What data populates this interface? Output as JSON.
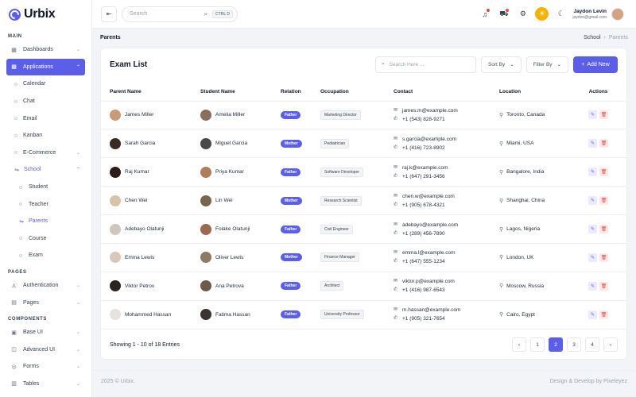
{
  "app": {
    "name": "Urbix"
  },
  "sidebar": {
    "sections": [
      {
        "label": "MAIN"
      },
      {
        "label": "PAGES"
      },
      {
        "label": "COMPONENTS"
      }
    ],
    "items": [
      {
        "label": "Dashboards",
        "icon": "grid-icon"
      },
      {
        "label": "Applications",
        "icon": "apps-icon"
      },
      {
        "label": "Calendar"
      },
      {
        "label": "Chat"
      },
      {
        "label": "Email"
      },
      {
        "label": "Kanban"
      },
      {
        "label": "E-Commerce"
      },
      {
        "label": "School"
      },
      {
        "label": "Student"
      },
      {
        "label": "Teacher"
      },
      {
        "label": "Parents"
      },
      {
        "label": "Course"
      },
      {
        "label": "Exam"
      },
      {
        "label": "Authentication"
      },
      {
        "label": "Pages"
      },
      {
        "label": "Base UI"
      },
      {
        "label": "Advanced UI"
      },
      {
        "label": "Forms"
      },
      {
        "label": "Tables"
      }
    ]
  },
  "header": {
    "search_placeholder": "Search",
    "shortcut": "CTRL D",
    "user_name": "Jaydon Levin",
    "user_email": "jaydon@gmail.com"
  },
  "breadcrumb": {
    "title": "Parents",
    "root": "School",
    "current": "Parents"
  },
  "card": {
    "title": "Exam List",
    "search_placeholder": "Search Here ...",
    "sort_label": "Sort By",
    "filter_label": "Filter By",
    "add_label": "Add New"
  },
  "table": {
    "headers": [
      "Parent Name",
      "Student Name",
      "Relation",
      "Occupation",
      "Contact",
      "Location",
      "Actions"
    ],
    "rows": [
      {
        "parent": "James Miller",
        "student": "Amelia Miller",
        "relation": "Father",
        "occupation": "Marketing Director",
        "email": "james.m@example.com",
        "phone": "+1 (543) 828-9271",
        "location": "Toronto, Canada",
        "pcolor": "#c79a7a",
        "scolor": "#8a6f5e"
      },
      {
        "parent": "Sarah Garcia",
        "student": "Miguel Garcia",
        "relation": "Mother",
        "occupation": "Pediatrician",
        "email": "s.garcia@example.com",
        "phone": "+1 (416) 723-8902",
        "location": "Miami, USA",
        "pcolor": "#3b2a22",
        "scolor": "#4a4a4a"
      },
      {
        "parent": "Raj Kumar",
        "student": "Priya Kumar",
        "relation": "Father",
        "occupation": "Software Developer",
        "email": "raj.k@example.com",
        "phone": "+1 (647) 291-3456",
        "location": "Bangalore, India",
        "pcolor": "#2b1e1a",
        "scolor": "#b07d5a"
      },
      {
        "parent": "Chen Wei",
        "student": "Lin Wei",
        "relation": "Mother",
        "occupation": "Research Scientist",
        "email": "chen.w@example.com",
        "phone": "+1 (905) 678-4321",
        "location": "Shanghai, China",
        "pcolor": "#d9c3a8",
        "scolor": "#7a6552"
      },
      {
        "parent": "Adebayo Olatunji",
        "student": "Folake Olatunji",
        "relation": "Father",
        "occupation": "Civil Engineer",
        "email": "adebayo@example.com",
        "phone": "+1 (289) 456-7890",
        "location": "Lagos, Nigeria",
        "pcolor": "#cfc7bd",
        "scolor": "#9a6a52"
      },
      {
        "parent": "Emma Lewis",
        "student": "Oliver Lewis",
        "relation": "Mother",
        "occupation": "Finance Manager",
        "email": "emma.l@example.com",
        "phone": "+1 (647) 555-1234",
        "location": "London, UK",
        "pcolor": "#d8c8bc",
        "scolor": "#8c7a64"
      },
      {
        "parent": "Viktor Petrov",
        "student": "Ana Petrova",
        "relation": "Father",
        "occupation": "Architect",
        "email": "viktor.p@example.com",
        "phone": "+1 (416) 987-6543",
        "location": "Moscow, Russia",
        "pcolor": "#2a2420",
        "scolor": "#6e5a4a"
      },
      {
        "parent": "Mohammed Hassan",
        "student": "Fatima Hassan",
        "relation": "Father",
        "occupation": "University Professor",
        "email": "m.hassan@example.com",
        "phone": "+1 (905) 321-7654",
        "location": "Cairo, Egypt",
        "pcolor": "#e6e2dd",
        "scolor": "#3c3430"
      }
    ]
  },
  "pagination": {
    "summary": "Showing 1 - 10 of 18 Entries",
    "pages": [
      "1",
      "2",
      "3",
      "4"
    ],
    "active": "2"
  },
  "footer": {
    "copyright": "2025 © Urbix.",
    "credit": "Design & Develop by Pixeleyez"
  },
  "colors": {
    "accent": "#5b5fe8",
    "danger": "#ef4444",
    "sun": "#f5b301"
  }
}
